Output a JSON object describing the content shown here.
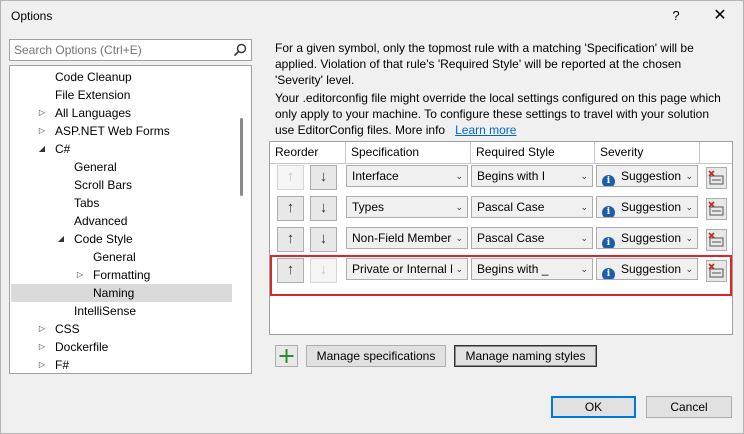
{
  "window": {
    "title": "Options",
    "help_glyph": "?",
    "close_glyph": "✕"
  },
  "search": {
    "placeholder": "Search Options (Ctrl+E)"
  },
  "tree": {
    "items": [
      {
        "label": "Code Cleanup",
        "expander": ""
      },
      {
        "label": "File Extension",
        "expander": ""
      },
      {
        "label": "All Languages",
        "expander": "collapsed"
      },
      {
        "label": "ASP.NET Web Forms",
        "expander": "collapsed"
      },
      {
        "label": "C#",
        "expander": "expanded"
      },
      {
        "label": "General",
        "expander": ""
      },
      {
        "label": "Scroll Bars",
        "expander": ""
      },
      {
        "label": "Tabs",
        "expander": ""
      },
      {
        "label": "Advanced",
        "expander": ""
      },
      {
        "label": "Code Style",
        "expander": "expanded"
      },
      {
        "label": "General",
        "expander": ""
      },
      {
        "label": "Formatting",
        "expander": "collapsed"
      },
      {
        "label": "Naming",
        "expander": "",
        "selected": true
      },
      {
        "label": "IntelliSense",
        "expander": ""
      },
      {
        "label": "CSS",
        "expander": "collapsed"
      },
      {
        "label": "Dockerfile",
        "expander": "collapsed"
      },
      {
        "label": "F#",
        "expander": "collapsed"
      }
    ]
  },
  "description": {
    "para1": "For a given symbol, only the topmost rule with a matching 'Specification' will be applied. Violation of that rule's 'Required Style' will be reported at the chosen 'Severity' level.",
    "para2": "Your .editorconfig file might override the local settings configured on this page which only apply to your machine. To configure these settings to travel with your solution use EditorConfig files. More info",
    "learn_more": "Learn more"
  },
  "grid": {
    "headers": {
      "reorder": "Reorder",
      "specification": "Specification",
      "required_style": "Required Style",
      "severity": "Severity"
    },
    "rows": [
      {
        "up_enabled": false,
        "down_enabled": true,
        "specification": "Interface",
        "required_style": "Begins with I",
        "severity": "Suggestion"
      },
      {
        "up_enabled": true,
        "down_enabled": true,
        "specification": "Types",
        "required_style": "Pascal Case",
        "severity": "Suggestion"
      },
      {
        "up_enabled": true,
        "down_enabled": true,
        "specification": "Non-Field Members",
        "required_style": "Pascal Case",
        "severity": "Suggestion"
      },
      {
        "up_enabled": true,
        "down_enabled": false,
        "specification": "Private or Internal Field",
        "required_style": "Begins with _",
        "severity": "Suggestion"
      }
    ]
  },
  "buttons": {
    "add": "+",
    "manage_specifications": "Manage specifications",
    "manage_naming_styles": "Manage naming styles",
    "ok": "OK",
    "cancel": "Cancel"
  },
  "colors": {
    "highlight_border": "#d9262a",
    "info_icon": "#1e5ea8",
    "link": "#0066cc",
    "add_icon": "#2e8b2e",
    "delete_icon": "#c42b1c"
  }
}
